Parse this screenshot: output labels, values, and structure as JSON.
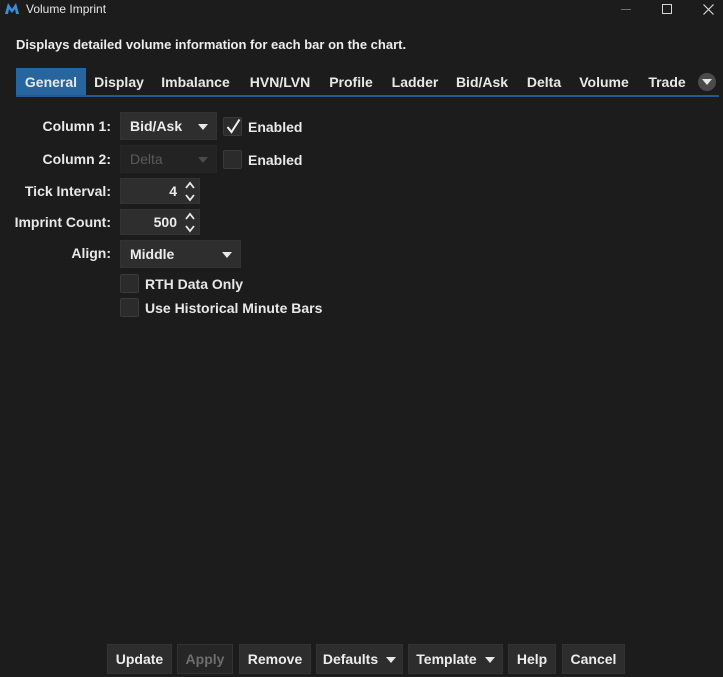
{
  "window": {
    "title": "Volume Imprint",
    "description": "Displays detailed volume information for each bar on the chart."
  },
  "tabs": [
    {
      "label": "General",
      "active": true
    },
    {
      "label": "Display"
    },
    {
      "label": "Imbalance"
    },
    {
      "label": "HVN/LVN"
    },
    {
      "label": "Profile"
    },
    {
      "label": "Ladder"
    },
    {
      "label": "Bid/Ask"
    },
    {
      "label": "Delta"
    },
    {
      "label": "Volume"
    },
    {
      "label": "Trade"
    }
  ],
  "form": {
    "column1": {
      "label": "Column 1:",
      "value": "Bid/Ask",
      "enabled_label": "Enabled",
      "enabled": true
    },
    "column2": {
      "label": "Column 2:",
      "value": "Delta",
      "enabled_label": "Enabled",
      "enabled": false,
      "disabled": true
    },
    "tick_interval": {
      "label": "Tick Interval:",
      "value": "4"
    },
    "imprint_count": {
      "label": "Imprint Count:",
      "value": "500"
    },
    "align": {
      "label": "Align:",
      "value": "Middle"
    },
    "rth_only": {
      "label": "RTH Data Only",
      "checked": false
    },
    "historical_minute": {
      "label": "Use Historical Minute Bars",
      "checked": false
    }
  },
  "buttons": {
    "update": "Update",
    "apply": "Apply",
    "remove": "Remove",
    "defaults": "Defaults",
    "template": "Template",
    "help": "Help",
    "cancel": "Cancel"
  },
  "colors": {
    "background": "#1c1c1c",
    "accent": "#27659f",
    "control": "#2e2e2e"
  },
  "icons": [
    "app-logo-icon",
    "minimize-icon",
    "maximize-icon",
    "close-icon",
    "chevron-down-icon",
    "checkmark-icon",
    "spinner-up-icon",
    "spinner-down-icon"
  ]
}
